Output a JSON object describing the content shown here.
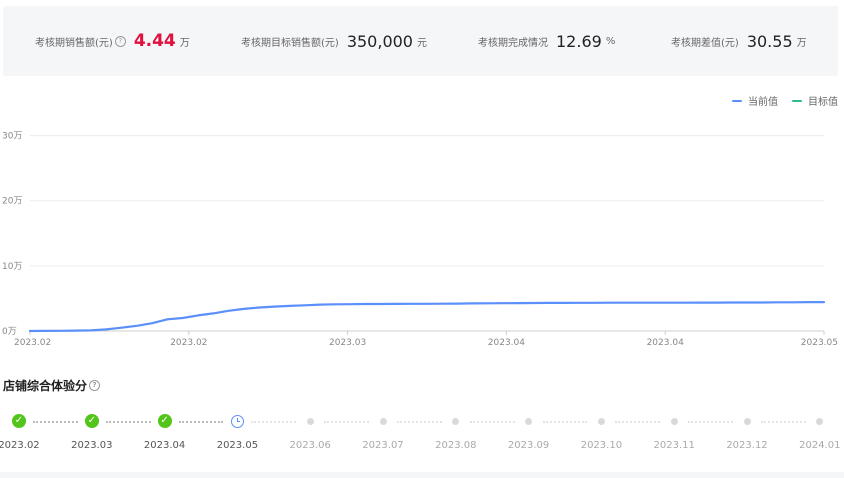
{
  "stats": [
    {
      "label": "考核期销售额(元)",
      "value": "4.44",
      "unit": "万",
      "help_icon": "question-circle-icon",
      "emphasis": true
    },
    {
      "label": "考核期目标销售额(元)",
      "value": "350,000",
      "unit": "元"
    },
    {
      "label": "考核期完成情况",
      "value": "12.69",
      "unit": "%"
    },
    {
      "label": "考核期差值(元)",
      "value": "30.55",
      "unit": "万"
    }
  ],
  "chart_data": {
    "type": "line",
    "x": [
      "2023.02",
      "2023.02",
      "2023.02",
      "2023.02",
      "2023.02",
      "2023.02",
      "2023.02",
      "2023.02",
      "2023.02",
      "2023.02",
      "2023.02",
      "2023.02",
      "2023.02",
      "2023.02",
      "2023.02",
      "2023.03",
      "2023.03",
      "2023.03",
      "2023.03",
      "2023.03",
      "2023.03",
      "2023.03",
      "2023.03",
      "2023.03",
      "2023.03",
      "2023.03",
      "2023.03",
      "2023.03",
      "2023.04",
      "2023.04",
      "2023.04",
      "2023.04",
      "2023.04",
      "2023.04",
      "2023.04",
      "2023.04",
      "2023.04",
      "2023.04",
      "2023.04",
      "2023.04",
      "2023.04",
      "2023.04",
      "2023.04",
      "2023.04",
      "2023.04",
      "2023.04",
      "2023.04",
      "2023.04",
      "2023.04",
      "2023.04",
      "2023.04",
      "2023.05",
      "2023.05"
    ],
    "x_ticks": [
      "2023.02",
      "2023.02",
      "2023.03",
      "2023.04",
      "2023.04",
      "2023.05"
    ],
    "series": [
      {
        "name": "当前值",
        "color": "#5b8ff9",
        "values": [
          0,
          100,
          300,
          600,
          900,
          2500,
          5000,
          8000,
          12000,
          18000,
          20000,
          24000,
          27000,
          31000,
          34000,
          36000,
          37500,
          38500,
          39500,
          40500,
          41000,
          41200,
          41400,
          41500,
          41600,
          41700,
          41800,
          41900,
          42000,
          42300,
          42500,
          42600,
          42800,
          43000,
          43100,
          43200,
          43300,
          43300,
          43400,
          43400,
          43400,
          43500,
          43500,
          43500,
          43600,
          43600,
          43700,
          43700,
          43800,
          44000,
          44100,
          44300,
          44400
        ]
      },
      {
        "name": "目标值",
        "color": "#2bbd8a",
        "values": "constant-350000"
      }
    ],
    "target_value": 350000,
    "y_ticks": [
      {
        "value": 0,
        "label": "0万"
      },
      {
        "value": 100000,
        "label": "10万"
      },
      {
        "value": 200000,
        "label": "20万"
      },
      {
        "value": 300000,
        "label": "30万"
      }
    ],
    "ylim": [
      0,
      350000
    ],
    "grid": true,
    "legend": "top-right",
    "title": "",
    "xlabel": "",
    "ylabel": ""
  },
  "score_section": {
    "title": "店铺综合体验分",
    "help_icon": "question-circle-icon",
    "months": [
      {
        "label": "2023.02",
        "status": "done"
      },
      {
        "label": "2023.03",
        "status": "done"
      },
      {
        "label": "2023.04",
        "status": "done"
      },
      {
        "label": "2023.05",
        "status": "current"
      },
      {
        "label": "2023.06",
        "status": "pending"
      },
      {
        "label": "2023.07",
        "status": "pending"
      },
      {
        "label": "2023.08",
        "status": "pending"
      },
      {
        "label": "2023.09",
        "status": "pending"
      },
      {
        "label": "2023.10",
        "status": "pending"
      },
      {
        "label": "2023.11",
        "status": "pending"
      },
      {
        "label": "2023.12",
        "status": "pending"
      },
      {
        "label": "2024.01",
        "status": "pending"
      }
    ]
  }
}
